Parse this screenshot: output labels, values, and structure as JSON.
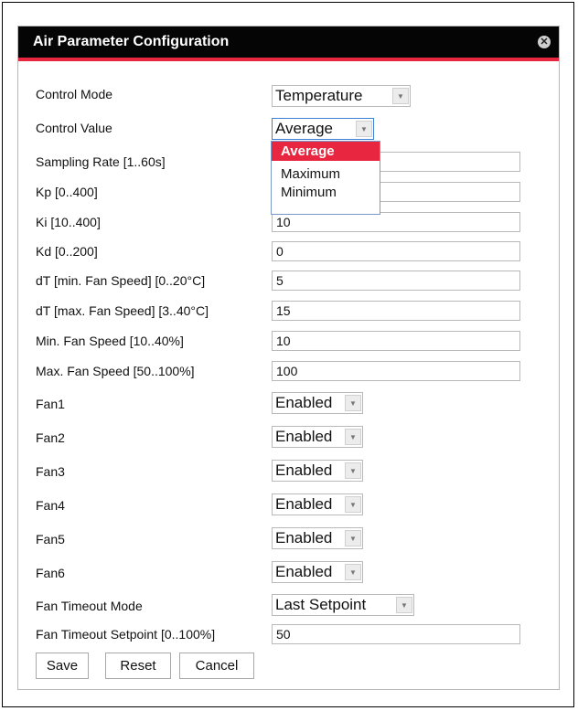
{
  "dialog": {
    "title": "Air Parameter Configuration"
  },
  "fields": {
    "control_mode": {
      "label": "Control Mode",
      "value": "Temperature"
    },
    "control_value": {
      "label": "Control Value",
      "value": "Average",
      "options": [
        "Average",
        "Maximum",
        "Minimum"
      ]
    },
    "sampling_rate": {
      "label": "Sampling Rate [1..60s]",
      "value": ""
    },
    "kp": {
      "label": "Kp [0..400]",
      "value": ""
    },
    "ki": {
      "label": "Ki [10..400]",
      "value": "10"
    },
    "kd": {
      "label": "Kd [0..200]",
      "value": "0"
    },
    "dt_min": {
      "label": "dT [min. Fan Speed] [0..20°C]",
      "value": "5"
    },
    "dt_max": {
      "label": "dT [max. Fan Speed] [3..40°C]",
      "value": "15"
    },
    "min_fan": {
      "label": "Min. Fan Speed [10..40%]",
      "value": "10"
    },
    "max_fan": {
      "label": "Max. Fan Speed [50..100%]",
      "value": "100"
    },
    "fan1": {
      "label": "Fan1",
      "value": "Enabled"
    },
    "fan2": {
      "label": "Fan2",
      "value": "Enabled"
    },
    "fan3": {
      "label": "Fan3",
      "value": "Enabled"
    },
    "fan4": {
      "label": "Fan4",
      "value": "Enabled"
    },
    "fan5": {
      "label": "Fan5",
      "value": "Enabled"
    },
    "fan6": {
      "label": "Fan6",
      "value": "Enabled"
    },
    "timeout_mode": {
      "label": "Fan Timeout Mode",
      "value": "Last Setpoint"
    },
    "timeout_setpoint": {
      "label": "Fan Timeout Setpoint [0..100%]",
      "value": "50"
    }
  },
  "buttons": {
    "save": "Save",
    "reset": "Reset",
    "cancel": "Cancel"
  },
  "icons": {
    "close": "close-icon",
    "dropdown": "chevron-down-icon"
  },
  "colors": {
    "accent": "#e8263f",
    "titlebar": "#050505"
  }
}
